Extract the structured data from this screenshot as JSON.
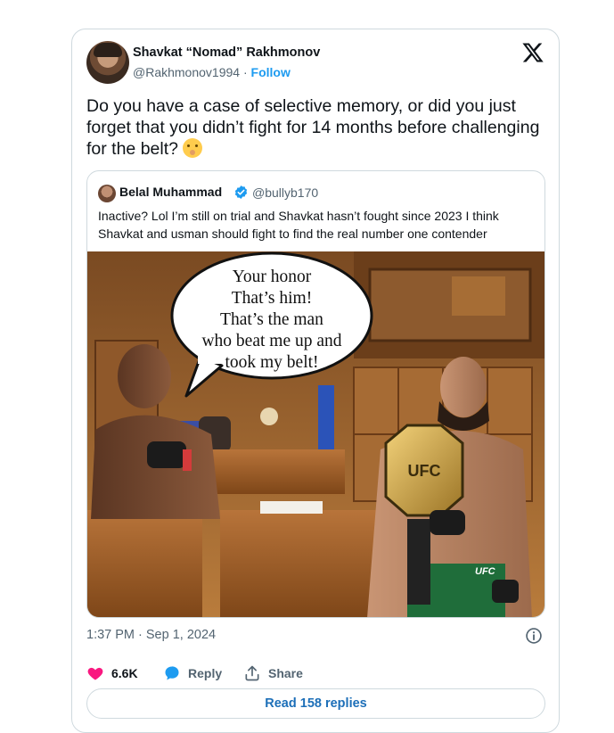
{
  "tweet": {
    "author_name": "Shavkat “Nomad” Rakhmonov",
    "author_handle": "@Rakhmonov1994",
    "separator": " · ",
    "follow_label": "Follow",
    "text": "Do you have a case of selective memory, or did you just forget that you didn’t fight for 14 months before challenging for the belt?",
    "timestamp": "1:37 PM · Sep 1, 2024",
    "like_count": "6.6K",
    "reply_label": "Reply",
    "share_label": "Share",
    "read_replies_label": "Read 158 replies"
  },
  "quoted": {
    "author_name": "Belal Muhammad",
    "author_handle": "@bullyb170",
    "text": "Inactive? Lol I’m still on trial and Shavkat hasn’t fought since 2023 I  think Shavkat and usman should fight to find the real number one contender",
    "image": {
      "speech_bubble_lines": [
        "Your honor",
        "That’s him!",
        "That’s the man",
        "who beat me up and",
        "took my belt!"
      ],
      "belt_text": "UFC",
      "shorts_text": "UFC"
    }
  },
  "colors": {
    "accent": "#1d9bf0",
    "like": "#f91880",
    "text": "#0f1419",
    "muted": "#536471",
    "border": "#cfd9de"
  },
  "icons": [
    "x-logo-icon",
    "verified-badge-icon",
    "info-icon",
    "heart-icon",
    "reply-bubble-icon",
    "share-icon",
    "emoji-shushing-face-icon"
  ]
}
